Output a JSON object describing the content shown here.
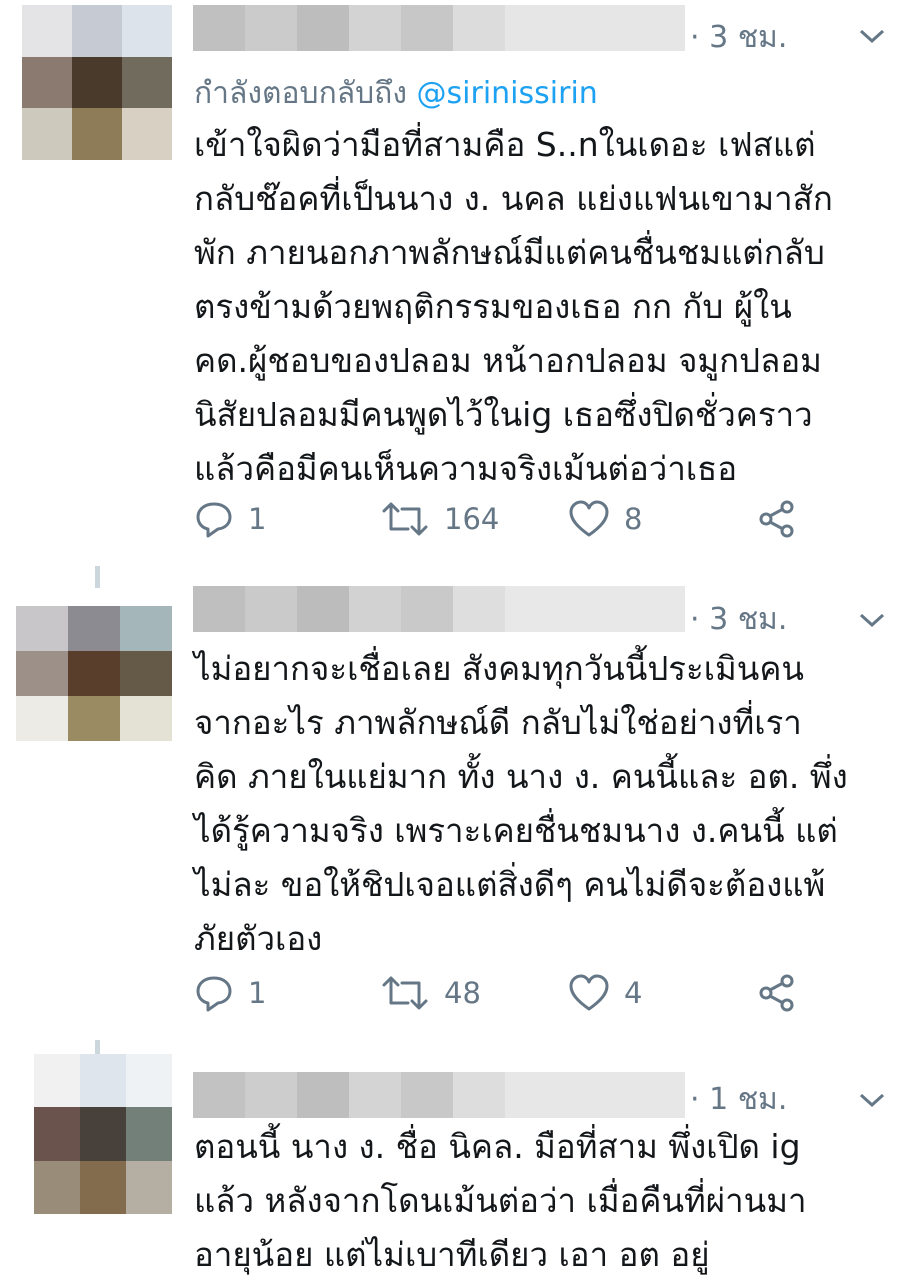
{
  "tweets": [
    {
      "time": "· 3 ชม.",
      "reply_prefix": "กำลังตอบกลับถึง ",
      "reply_handle": "@sirinissirin",
      "text": "เข้าใจผิดว่ามือที่สามคือ S..nในเดอะ เฟสแต่\nกลับช๊อคที่เป็นนาง ง. นคล แย่งแฟนเขามาสัก\nพัก ภายนอกภาพลักษณ์มีแต่คนชื่นชมแต่กลับ\nตรงข้ามด้วยพฤติกรรมของเธอ กก กับ ผู้ใน\nคด.ผู้ชอบของปลอม หน้าอกปลอม จมูกปลอม\nนิสัยปลอมมีคนพูดไว้ในig เธอซึ่งปิดชั่วคราว\nแล้วคือมีคนเห็นความจริงเม้นต่อว่าเธอ",
      "replies": "1",
      "retweets": "164",
      "likes": "8"
    },
    {
      "time": "· 3 ชม.",
      "text": "ไม่อยากจะเชื่อเลย สังคมทุกวันนี้ประเมินคน\nจากอะไร ภาพลักษณ์ดี กลับไม่ใช่อย่างที่เรา\nคิด ภายในแย่มาก ทั้ง นาง ง. คนนี้และ อต. พึ่ง\nได้รู้ความจริง เพราะเคยชื่นชมนาง ง.คนนี้ แต่\nไม่ละ ขอให้ชิปเจอแต่สิ่งดีๆ คนไม่ดีจะต้องแพ้\nภัยตัวเอง",
      "replies": "1",
      "retweets": "48",
      "likes": "4"
    },
    {
      "time": "· 1 ชม.",
      "text": "ตอนนี้ นาง ง. ชื่อ นิคล. มือที่สาม พึ่งเปิด ig\nแล้ว หลังจากโดนเม้นต่อว่า เมื่อคืนที่ผ่านมา\nอายุน้อย แต่ไม่เบาทีเดียว เอา อต อยู่"
    }
  ],
  "icons": {
    "reply": "reply-icon",
    "retweet": "retweet-icon",
    "like": "heart-icon",
    "share": "share-icon",
    "menu": "chevron-down-icon"
  },
  "colors": {
    "text": "#14171a",
    "muted": "#657786",
    "link": "#1da1f2"
  }
}
